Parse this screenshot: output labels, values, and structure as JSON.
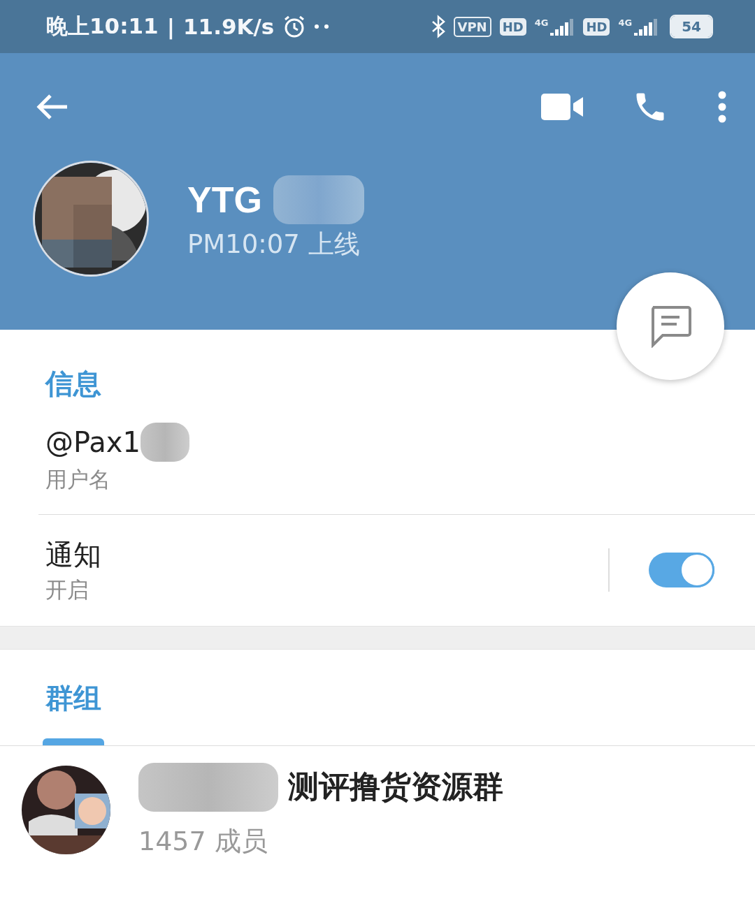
{
  "status_bar": {
    "time": "晚上10:11",
    "separator": "|",
    "speed": "11.9K/s",
    "vpn": "VPN",
    "hd_badges": [
      "HD",
      "HD"
    ],
    "network_labels": [
      "4G",
      "4G"
    ],
    "battery": "54"
  },
  "header": {
    "name": "YTG",
    "last_seen": "PM10:07 上线"
  },
  "info": {
    "title": "信息",
    "username": "@Pax1",
    "username_label": "用户名",
    "notifications": {
      "label": "通知",
      "status": "开启",
      "on": true
    }
  },
  "groups": {
    "title": "群组",
    "items": [
      {
        "name": "测评撸货资源群",
        "members": "1457 成员"
      }
    ]
  }
}
